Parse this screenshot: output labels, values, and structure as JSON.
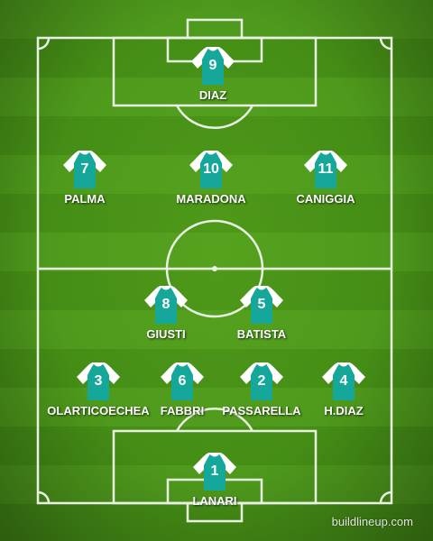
{
  "colors": {
    "pitch_light": "#4e9a1c",
    "pitch_dark": "#458e16",
    "shirt_body": "#15a89a",
    "shirt_sleeves": "#ffffff",
    "lines": "#e9f2e2"
  },
  "shirt_icon": "jersey-icon",
  "players": [
    {
      "number": "9",
      "name": "DIAZ"
    },
    {
      "number": "7",
      "name": "PALMA"
    },
    {
      "number": "10",
      "name": "MARADONA"
    },
    {
      "number": "11",
      "name": "CANIGGIA"
    },
    {
      "number": "8",
      "name": "GIUSTI"
    },
    {
      "number": "5",
      "name": "BATISTA"
    },
    {
      "number": "3",
      "name": "OLARTICOECHEA"
    },
    {
      "number": "6",
      "name": "FABBRI"
    },
    {
      "number": "2",
      "name": "PASSARELLA"
    },
    {
      "number": "4",
      "name": "H.DIAZ"
    },
    {
      "number": "1",
      "name": "LANARI"
    }
  ],
  "watermark": "buildlineup.com"
}
